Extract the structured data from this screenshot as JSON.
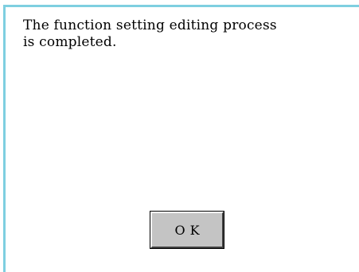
{
  "dialog": {
    "message": "The function setting editing process\nis completed.",
    "ok_label": "OK"
  },
  "colors": {
    "frame_border": "#7ecfe0",
    "button_face": "#c4c4c4"
  }
}
